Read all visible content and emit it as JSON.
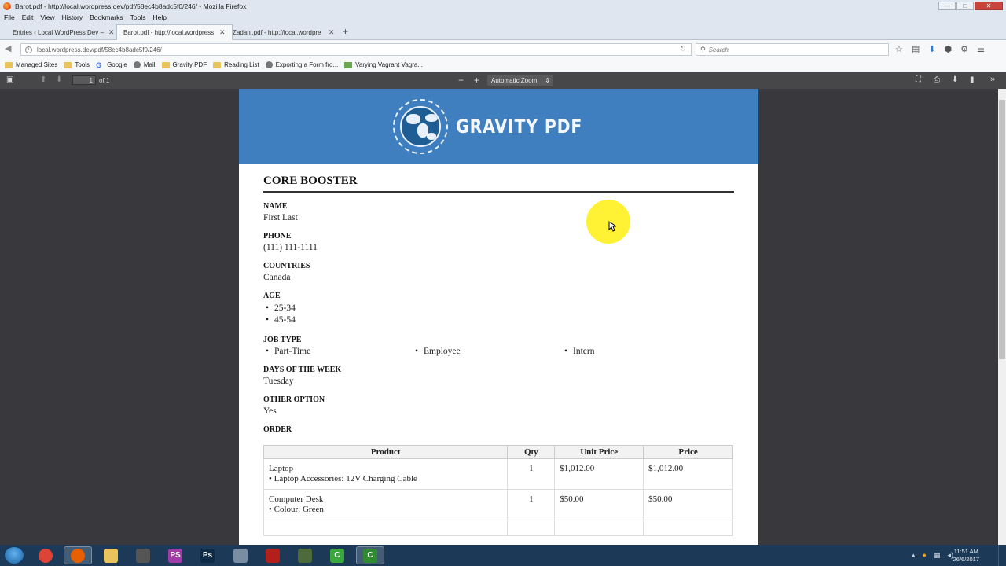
{
  "window": {
    "title": "Barot.pdf - http://local.wordpress.dev/pdf/58ec4b8adc5f0/246/ - Mozilla Firefox",
    "buttons": {
      "minimize": "—",
      "maximize": "□",
      "close": "✕"
    }
  },
  "menu": [
    "File",
    "Edit",
    "View",
    "History",
    "Bookmarks",
    "Tools",
    "Help"
  ],
  "tabs": [
    {
      "label": "Entries ‹ Local WordPress Dev — ",
      "active": false
    },
    {
      "label": "Barot.pdf - http://local.wordpress",
      "active": true
    },
    {
      "label": "Zadani.pdf - http://local.wordpre",
      "active": false
    }
  ],
  "newtab": "+",
  "nav": {
    "url": "local.wordpress.dev/pdf/58ec4b8adc5f0/246/",
    "search_placeholder": "Search"
  },
  "bookmarks": [
    {
      "label": "Managed Sites",
      "icon": "folder-icon"
    },
    {
      "label": "Tools",
      "icon": "folder-icon"
    },
    {
      "label": "Google",
      "icon": "google-icon"
    },
    {
      "label": "Mail",
      "icon": "globe-icon"
    },
    {
      "label": "Gravity PDF",
      "icon": "folder-icon"
    },
    {
      "label": "Reading List",
      "icon": "folder-icon"
    },
    {
      "label": "Exporting a Form fro...",
      "icon": "globe-icon"
    },
    {
      "label": "Varying Vagrant Vagra...",
      "icon": "vvv-icon"
    }
  ],
  "pdf_toolbar": {
    "page_number": "1",
    "page_count": "of 1",
    "zoom": "Automatic Zoom",
    "zoom_out": "−",
    "zoom_in": "+"
  },
  "document": {
    "logo_text": "GRAVITY PDF",
    "title": "CORE BOOSTER",
    "fields": {
      "name_label": "NAME",
      "name_value": "First Last",
      "phone_label": "PHONE",
      "phone_value": "(111) 111-1111",
      "countries_label": "COUNTRIES",
      "countries_value": "Canada",
      "age_label": "AGE",
      "age_values": [
        "25-34",
        "45-54"
      ],
      "job_label": "JOB TYPE",
      "job_values": [
        "Part-Time",
        "Employee",
        "Intern"
      ],
      "days_label": "DAYS OF THE WEEK",
      "days_value": "Tuesday",
      "other_label": "OTHER OPTION",
      "other_value": "Yes",
      "order_label": "ORDER"
    },
    "order_table": {
      "headers": [
        "Product",
        "Qty",
        "Unit Price",
        "Price"
      ],
      "rows": [
        {
          "product": "Laptop",
          "option": "• Laptop Accessories: 12V Charging Cable",
          "qty": "1",
          "unit": "$1,012.00",
          "price": "$1,012.00"
        },
        {
          "product": "Computer Desk",
          "option": "• Colour: Green",
          "qty": "1",
          "unit": "$50.00",
          "price": "$50.00"
        }
      ]
    }
  },
  "taskbar": {
    "apps": [
      {
        "name": "chrome-icon",
        "glyph": "",
        "color": "#db4437"
      },
      {
        "name": "firefox-icon",
        "glyph": "",
        "color": "#e66000"
      },
      {
        "name": "explorer-icon",
        "glyph": "",
        "color": "#e9c45c"
      },
      {
        "name": "terminal-icon",
        "glyph": "",
        "color": "#555555"
      },
      {
        "name": "phpstorm-icon",
        "glyph": "PS",
        "color": "#a23aa8"
      },
      {
        "name": "photoshop-icon",
        "glyph": "Ps",
        "color": "#0d2b45"
      },
      {
        "name": "remote-icon",
        "glyph": "",
        "color": "#7a8ea3"
      },
      {
        "name": "acrobat-icon",
        "glyph": "",
        "color": "#b3201c"
      },
      {
        "name": "vm-icon",
        "glyph": "",
        "color": "#4c6a3a"
      },
      {
        "name": "camtasia-icon",
        "glyph": "C",
        "color": "#3aa83a"
      },
      {
        "name": "camtasia-recorder-icon",
        "glyph": "C",
        "color": "#2e8b2e"
      }
    ],
    "time": "11:51 AM",
    "date": "26/6/2017"
  }
}
